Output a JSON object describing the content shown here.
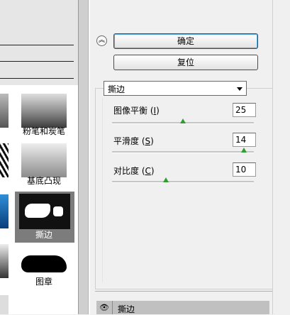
{
  "buttons": {
    "ok": "确定",
    "reset": "复位"
  },
  "collapse_icon": "double-chevron-up-icon",
  "filter_select": {
    "value": "撕边"
  },
  "params": [
    {
      "label": "图像平衡",
      "accel": "I",
      "value": "25",
      "level": 0.5
    },
    {
      "label": "平滑度",
      "accel": "S",
      "value": "14",
      "level": 0.93
    },
    {
      "label": "对比度",
      "accel": "C",
      "value": "10",
      "level": 0.38
    }
  ],
  "gallery": [
    {
      "caption": "粉笔和炭笔"
    },
    {
      "caption": "基底凸现"
    },
    {
      "caption": "撕边",
      "selected": true
    },
    {
      "caption": "图章"
    }
  ],
  "layers": {
    "item": "撕边",
    "eye_icon": "eye-icon"
  },
  "colors": {
    "slider_thumb": "#2f9e2f",
    "button_focus": "#59aee6"
  }
}
